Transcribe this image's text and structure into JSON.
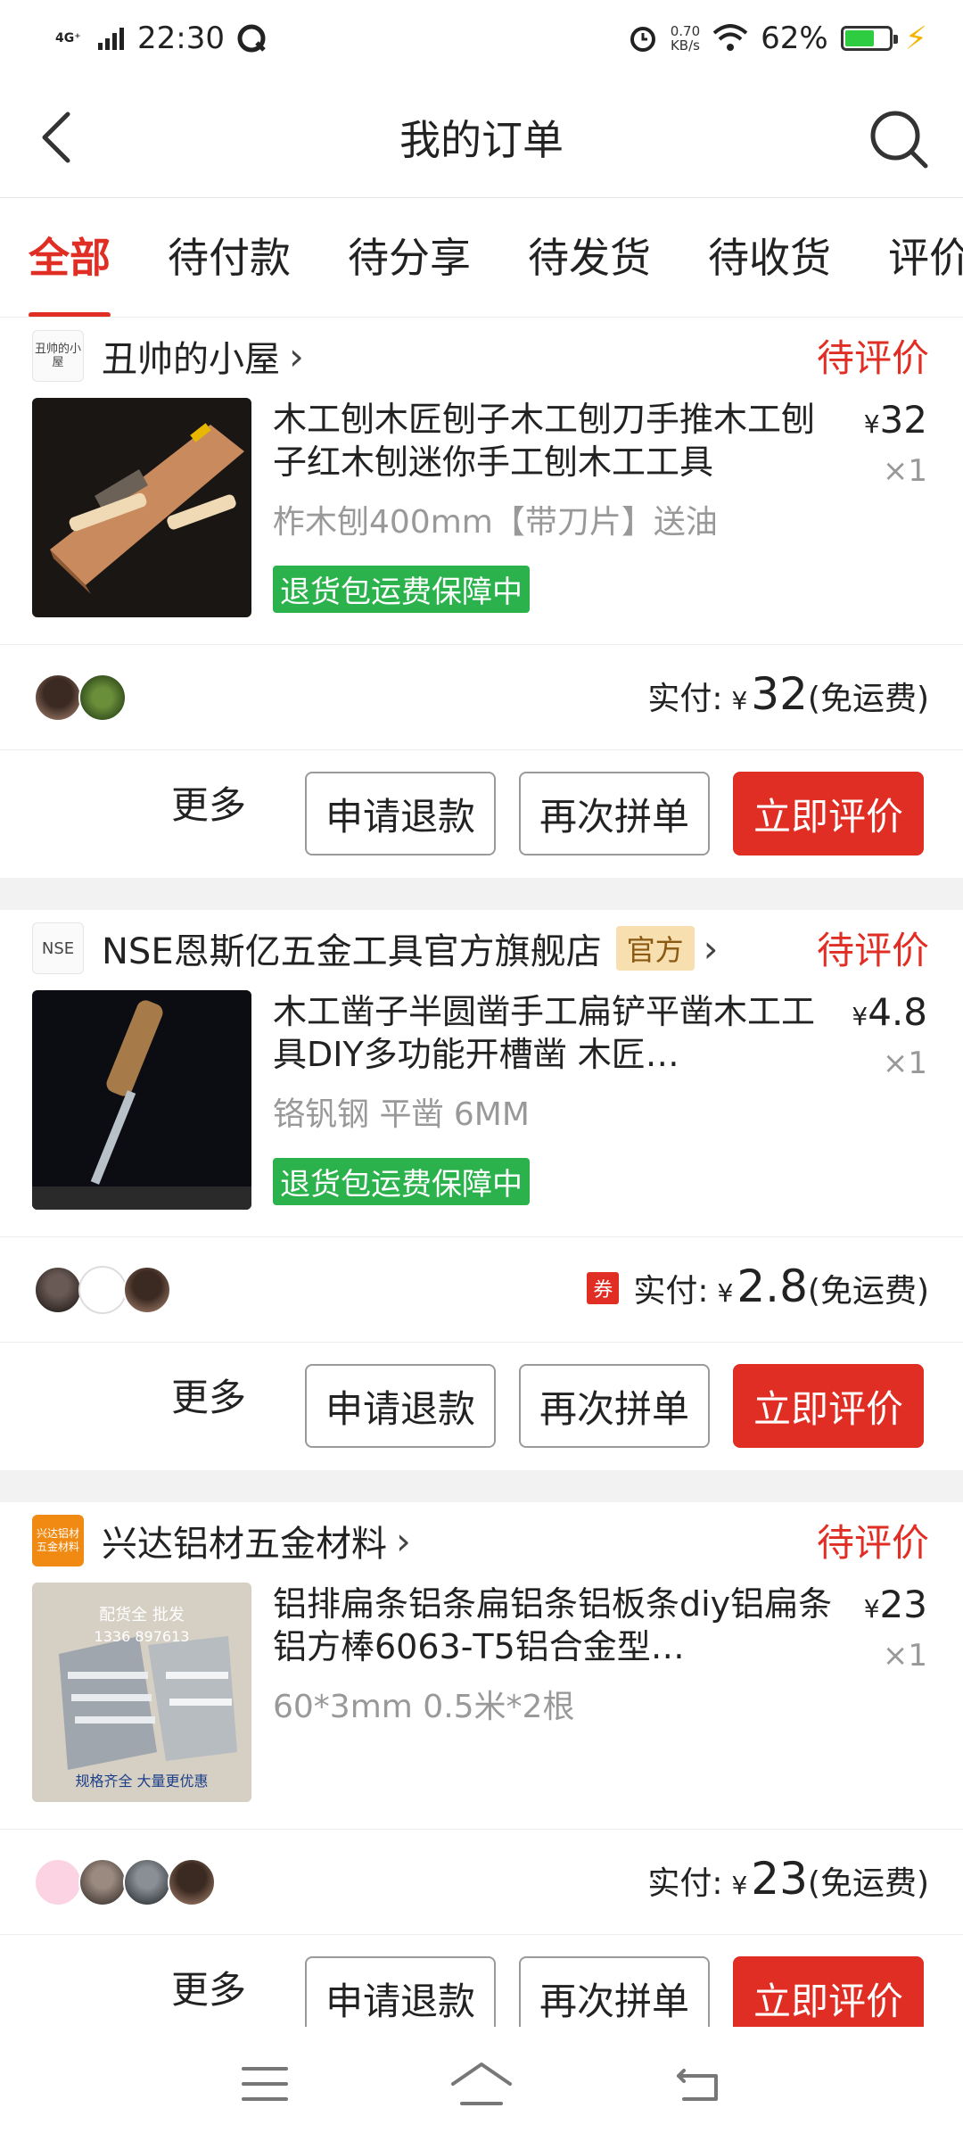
{
  "status_bar": {
    "network": "4G⁺",
    "time": "22:30",
    "speed_value": "0.70",
    "speed_unit": "KB/s",
    "battery": "62%",
    "battery_level": 0.62
  },
  "header": {
    "title": "我的订单"
  },
  "tabs": [
    "全部",
    "待付款",
    "待分享",
    "待发货",
    "待收货",
    "评价"
  ],
  "colors": {
    "accent": "#e02e24",
    "badge_green": "#2bb24c",
    "official_bg": "#f8dfb0"
  },
  "orders": [
    {
      "shop_logo": "丑帅的小屋",
      "shop_name": "丑帅的小屋",
      "status": "待评价",
      "product_title": "木工刨木匠刨子木工刨刀手推木工刨子红木刨迷你手工刨木工工具",
      "spec": "柞木刨400mm【带刀片】送油",
      "badge": "退货包运费保障中",
      "price": "32",
      "qty": "×1",
      "pay_label": "实付:",
      "pay_amount": "32",
      "shipping": "(免运费)",
      "more": "更多",
      "btn_refund": "申请退款",
      "btn_rebuy": "再次拼单",
      "btn_review": "立即评价"
    },
    {
      "shop_logo": "NSE",
      "shop_name": "NSE恩斯亿五金工具官方旗舰店",
      "official_tag": "官方",
      "status": "待评价",
      "product_title": "木工凿子半圆凿手工扁铲平凿木工工具DIY多功能开槽凿 木匠…",
      "spec": "铬钒钢 平凿 6MM",
      "badge": "退货包运费保障中",
      "price": "4.8",
      "qty": "×1",
      "coupon": "券",
      "pay_label": "实付:",
      "pay_amount": "2.8",
      "shipping": "(免运费)",
      "more": "更多",
      "btn_refund": "申请退款",
      "btn_rebuy": "再次拼单",
      "btn_review": "立即评价"
    },
    {
      "shop_logo": "兴达铝材五金材料",
      "shop_name": "兴达铝材五金材料",
      "status": "待评价",
      "product_title": "铝排扁条铝条扁铝条铝板条diy铝扁条铝方棒6063-T5铝合金型…",
      "spec": "60*3mm 0.5米*2根",
      "price": "23",
      "qty": "×1",
      "pay_label": "实付:",
      "pay_amount": "23",
      "shipping": "(免运费)",
      "more": "更多",
      "btn_refund": "申请退款",
      "btn_rebuy": "再次拼单",
      "btn_review": "立即评价",
      "thumb_text_1": "配货全 批发",
      "thumb_text_2": "1336 897613",
      "thumb_text_3": "规格齐全 大量更优惠"
    }
  ],
  "currency": "¥"
}
